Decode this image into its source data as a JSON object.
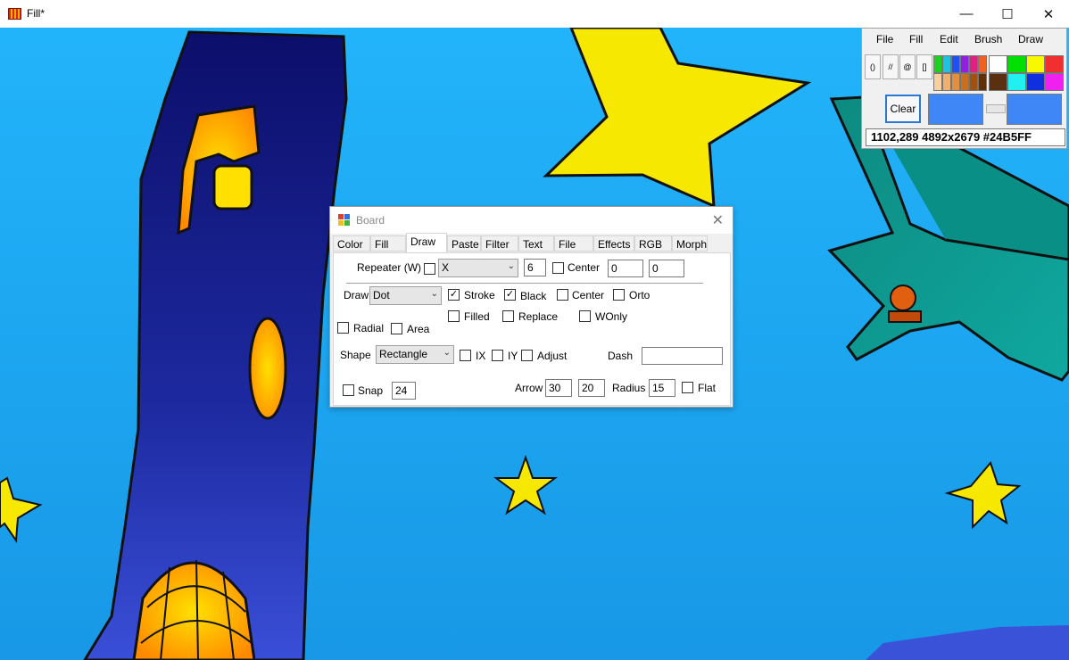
{
  "window": {
    "title": "Fill*",
    "controls": {
      "minimize": "—",
      "maximize": "☐",
      "close": "✕"
    }
  },
  "toolpanel": {
    "menu": [
      "File",
      "Fill",
      "Edit",
      "Brush",
      "Draw"
    ],
    "small_buttons": [
      "()",
      "//",
      "@",
      "[]"
    ],
    "palette": [
      [
        "#20d020",
        "#20c0e0",
        "#2050f0",
        "#9020e0",
        "#e02080",
        "#f06020"
      ],
      [
        "#f8d0a0",
        "#f0b070",
        "#e09040",
        "#c87020",
        "#a05010",
        "#603008"
      ]
    ],
    "palette_big": [
      [
        "#ffffff",
        "#00e000",
        "#f8f800",
        "#f03030"
      ],
      [
        "#5a3010",
        "#20f0f0",
        "#1030e0",
        "#f020f0"
      ]
    ],
    "clear_label": "Clear",
    "primary_color": "#3f86f6",
    "secondary_color": "#3f86f6",
    "status": "1102,289 4892x2679  #24B5FF"
  },
  "dialog": {
    "title": "Board",
    "tabs": [
      "Color",
      "Fill",
      "Draw",
      "Paste",
      "Filter",
      "Text",
      "File",
      "Effects",
      "RGB",
      "Morph"
    ],
    "active_tab": "Draw",
    "repeater": {
      "label": "Repeater (W)",
      "checked": false,
      "axis": "X",
      "count": "6",
      "center_label": "Center",
      "center_checked": false,
      "x": "0",
      "y": "0"
    },
    "draw": {
      "label": "Draw",
      "value": "Dot",
      "stroke": "Stroke",
      "stroke_checked": "✓",
      "black": "Black",
      "black_checked": "✓",
      "center": "Center",
      "orto": "Orto",
      "filled": "Filled",
      "replace": "Replace",
      "wonly": "WOnly",
      "radial": "Radial",
      "area": "Area"
    },
    "shape": {
      "label": "Shape",
      "value": "Rectangle",
      "ix": "IX",
      "iy": "IY",
      "adjust": "Adjust",
      "dash_label": "Dash",
      "dash_value": ""
    },
    "snap": {
      "label": "Snap",
      "value": "24"
    },
    "arrow": {
      "label": "Arrow",
      "a": "30",
      "b": "20"
    },
    "radius": {
      "label": "Radius",
      "value": "15"
    },
    "flat": "Flat"
  }
}
